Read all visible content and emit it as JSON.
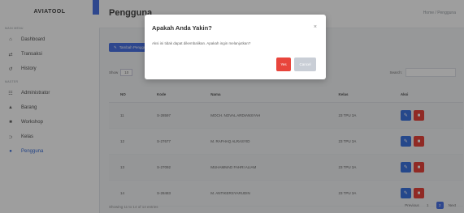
{
  "app": {
    "brand": "AVIATOOL"
  },
  "sidebar": {
    "section1": "MAIN MENU",
    "items1": [
      {
        "label": "Dashboard",
        "icon": "home-icon",
        "glyph": "⌂"
      },
      {
        "label": "Transaksi",
        "icon": "exchange-icon",
        "glyph": "⇄"
      },
      {
        "label": "History",
        "icon": "history-icon",
        "glyph": "↺"
      }
    ],
    "section2": "MASTER",
    "items2": [
      {
        "label": "Administrator",
        "icon": "users-icon",
        "glyph": "☷"
      },
      {
        "label": "Barang",
        "icon": "boxes-icon",
        "glyph": "▲"
      },
      {
        "label": "Workshop",
        "icon": "workshop-icon",
        "glyph": "■"
      },
      {
        "label": "Kelas",
        "icon": "class-icon",
        "glyph": "⊃"
      },
      {
        "label": "Pengguna",
        "icon": "user-icon",
        "glyph": "●"
      }
    ]
  },
  "header": {
    "title": "Pengguna",
    "breadcrumb": "Home / Pengguna"
  },
  "toolbar": {
    "add_label": "Tambah Pengguna"
  },
  "table": {
    "show_label": "Show",
    "show_value": "10",
    "search_label": "Search:",
    "columns": [
      "NO",
      "Kode",
      "Nama",
      "Kelas",
      "Aksi"
    ],
    "rows": [
      {
        "no": "11",
        "kode": "S-28597",
        "nama": "MOCH. NOVAL ARDIANSYAH",
        "kelas": "23 TPU 3A"
      },
      {
        "no": "12",
        "kode": "S-27677",
        "nama": "M. RAFHAQ ALRASYID",
        "kelas": "23 TPU 3A"
      },
      {
        "no": "13",
        "kode": "S-27092",
        "nama": "MUHAMMAD FAHRI ALIAM",
        "kelas": "23 TPU 3A"
      },
      {
        "no": "14",
        "kode": "S-28483",
        "nama": "M. ANTIKERSYARUDIN",
        "kelas": "23 TPU 3A"
      }
    ],
    "footer": "Showing 11 to 14 of 14 entries",
    "pagination": {
      "prev": "Previous",
      "pages": [
        "1",
        "2"
      ],
      "active": "2",
      "next": "Next"
    }
  },
  "modal": {
    "title": "Apakah Anda Yakin?",
    "close": "×",
    "body": "Aksi ini tidak dapat dikembalikan. Apakah ingin melanjutkan?",
    "yes_label": "Yes",
    "cancel_label": "Cancel"
  },
  "colors": {
    "accent": "#4b73e6",
    "danger": "#e8453c",
    "muted": "#c9ced6"
  }
}
